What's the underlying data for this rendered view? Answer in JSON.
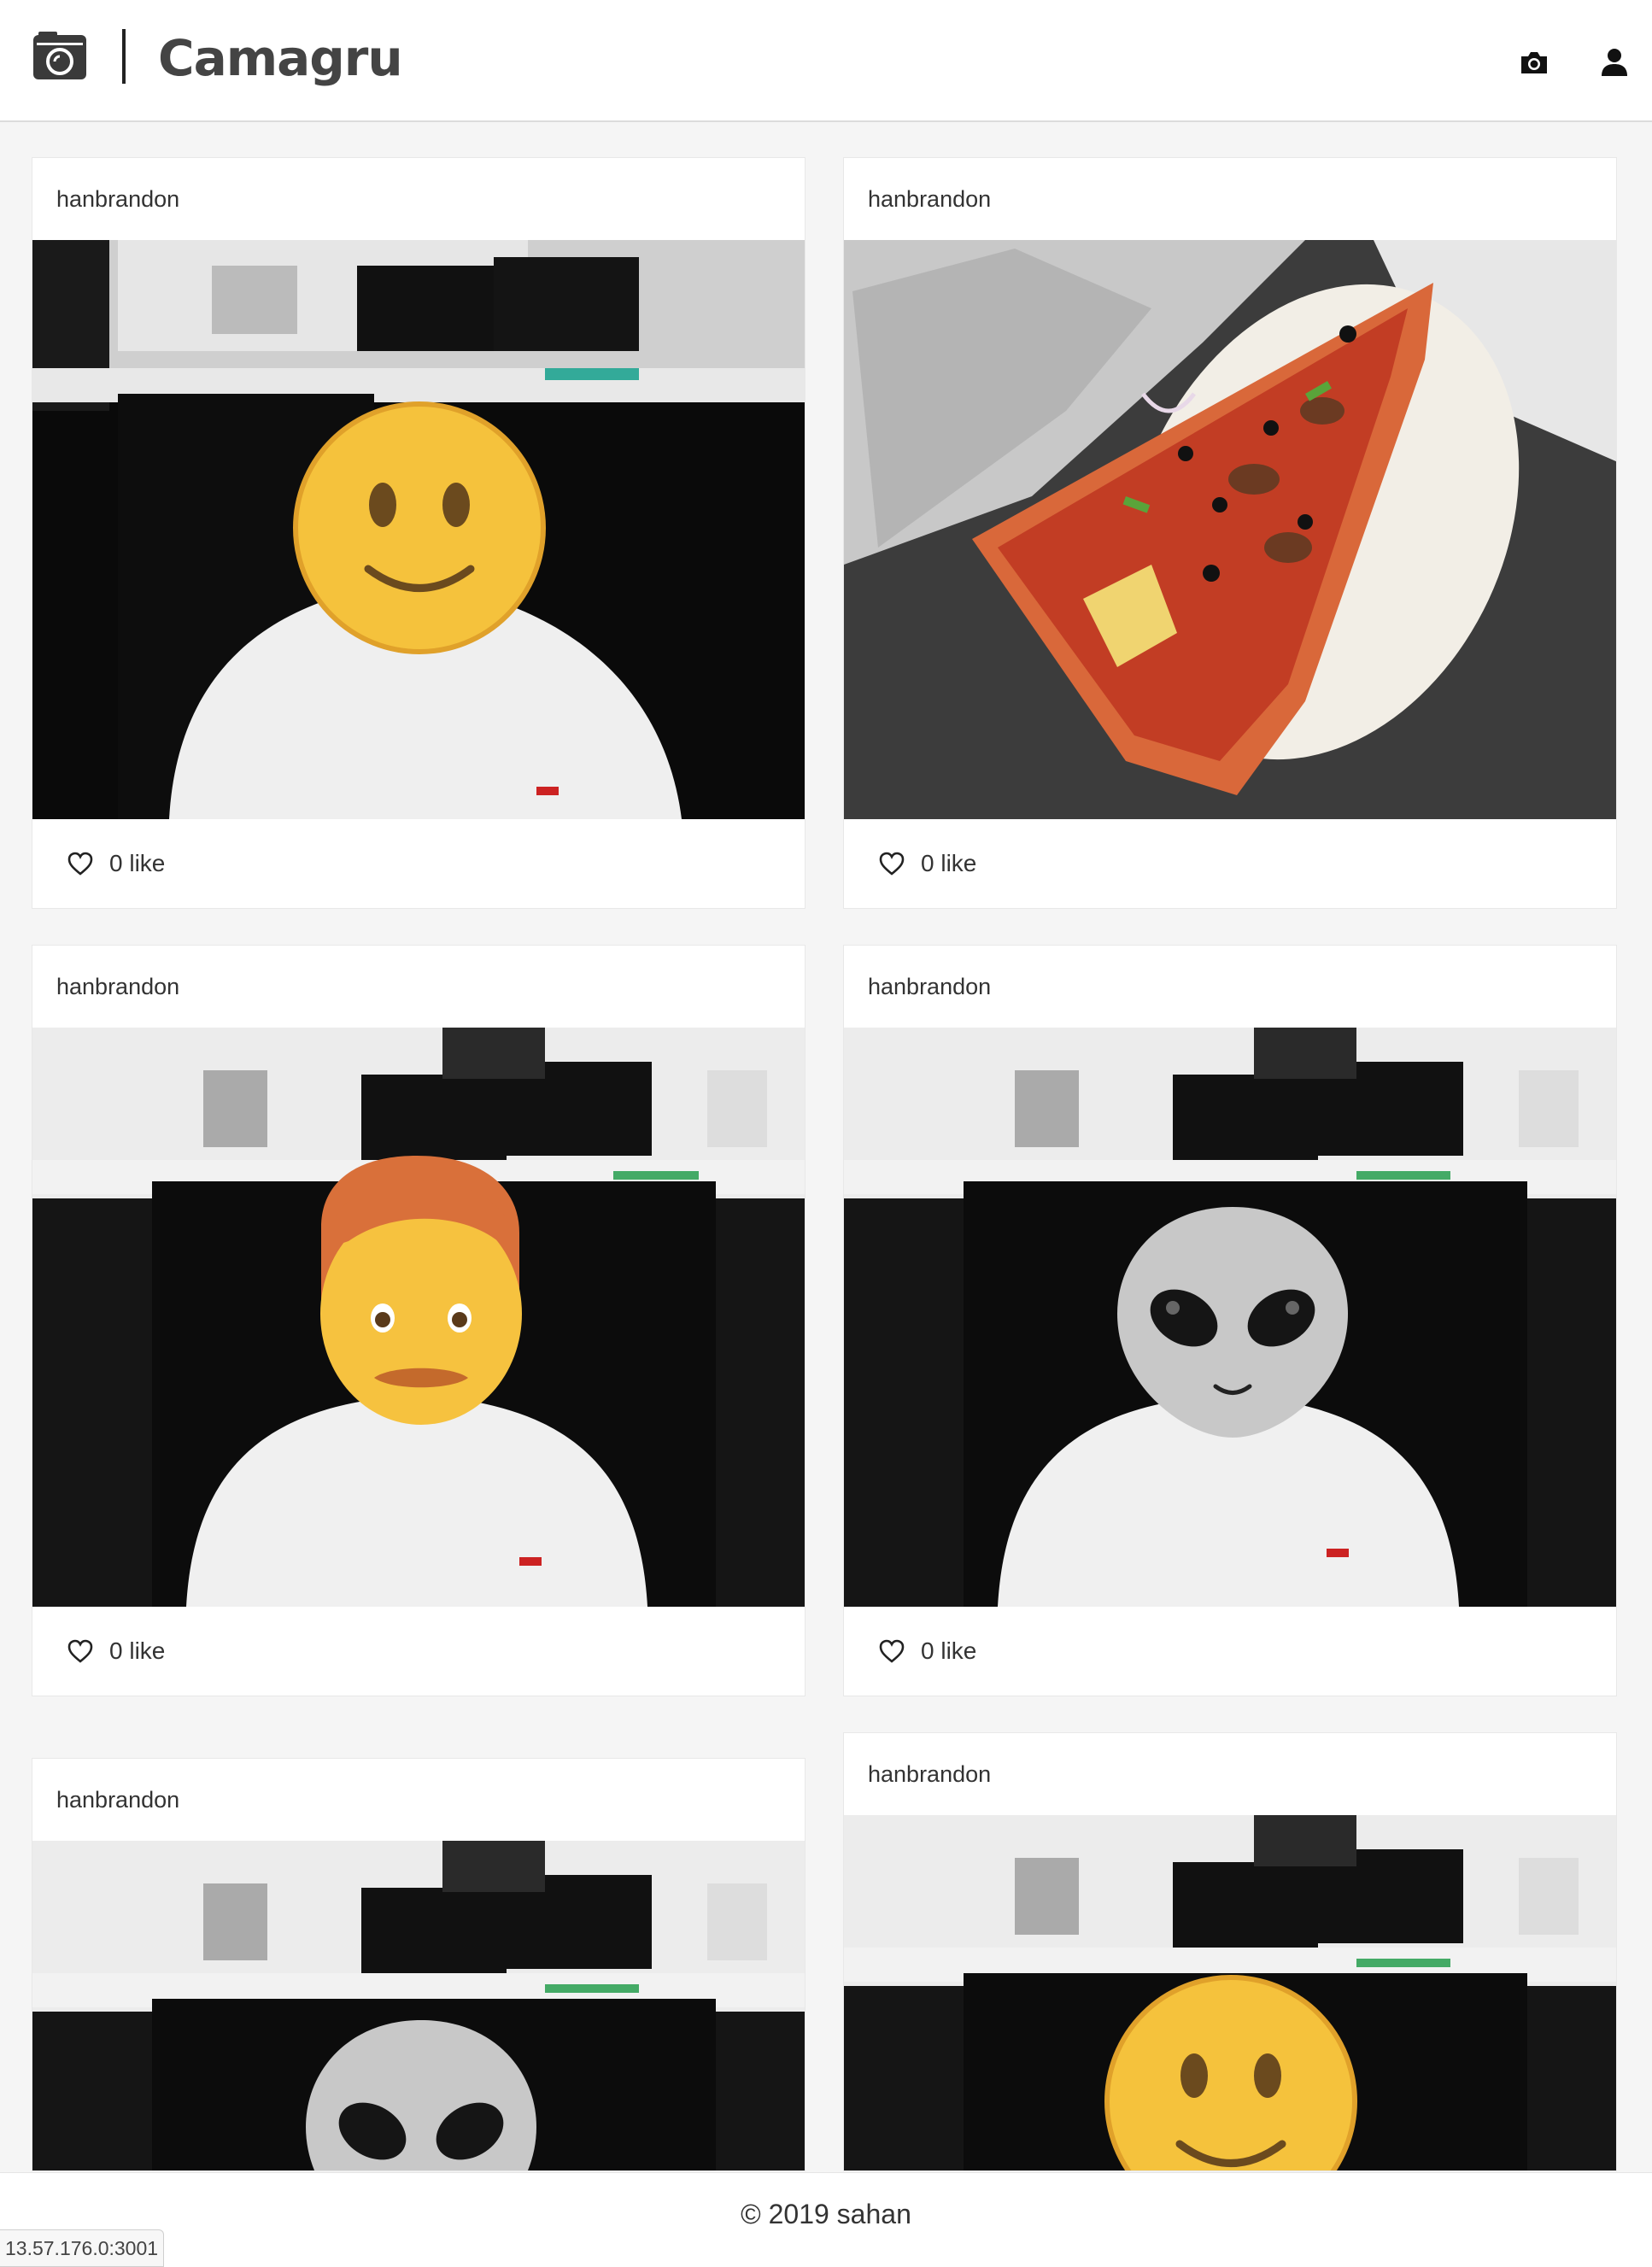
{
  "header": {
    "title": "Camagru",
    "logo_icon": "camera-logo-icon",
    "nav": [
      {
        "icon": "camera-icon"
      },
      {
        "icon": "user-icon"
      }
    ]
  },
  "posts": [
    {
      "author": "hanbrandon",
      "likes": "0 like",
      "photo": "person-smiley-face"
    },
    {
      "author": "hanbrandon",
      "likes": "0 like",
      "photo": "pizza-slice"
    },
    {
      "author": "hanbrandon",
      "likes": "0 like",
      "photo": "person-man-face"
    },
    {
      "author": "hanbrandon",
      "likes": "0 like",
      "photo": "person-alien-face"
    },
    {
      "author": "hanbrandon",
      "photo": "office-alien-face"
    },
    {
      "author": "hanbrandon",
      "photo": "office-smiley-face"
    }
  ],
  "footer": {
    "copyright": "© 2019 sahan"
  },
  "status_bar": {
    "url": "13.57.176.0:3001"
  },
  "colors": {
    "background": "#f5f5f5",
    "card": "#ffffff",
    "text": "#333333"
  }
}
